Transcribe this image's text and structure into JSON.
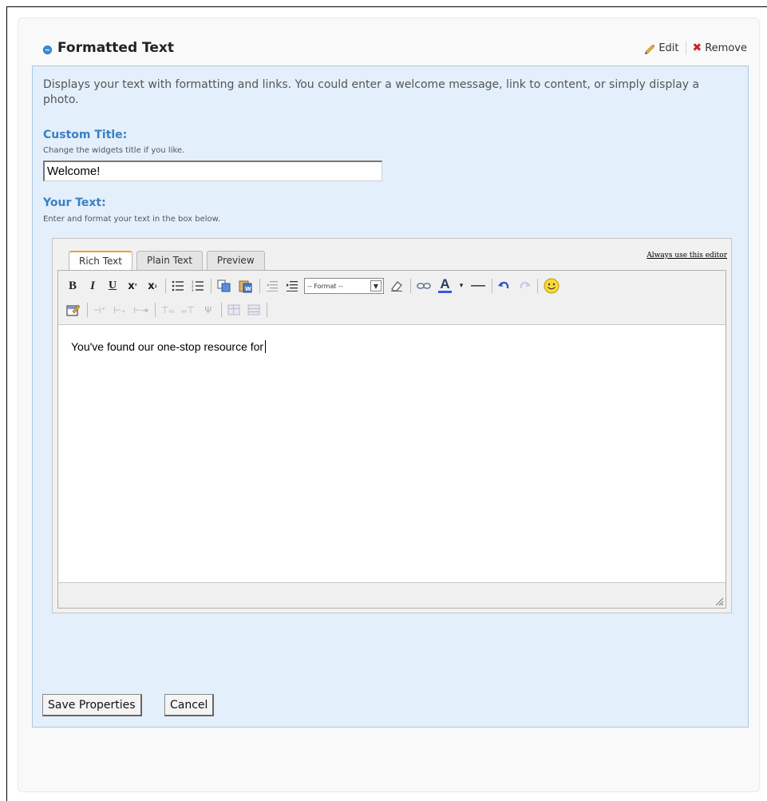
{
  "widget": {
    "title": "Formatted Text",
    "edit_label": "Edit",
    "remove_label": "Remove"
  },
  "description": "Displays your text with formatting and links. You could enter a welcome message, link to content, or simply display a photo.",
  "custom_title": {
    "label": "Custom Title:",
    "hint": "Change the widgets title if you like.",
    "value": "Welcome!"
  },
  "your_text": {
    "label": "Your Text:",
    "hint": "Enter and format your text in the box below."
  },
  "editor": {
    "tabs": [
      {
        "label": "Rich Text",
        "active": true
      },
      {
        "label": "Plain Text",
        "active": false
      },
      {
        "label": "Preview",
        "active": false
      }
    ],
    "always_use_label": "Always use this editor",
    "format_select_value": "-- Format --",
    "content": "You've found our one-stop resource for",
    "toolbar_icons_row1": [
      "bold-icon",
      "italic-icon",
      "underline-icon",
      "superscript-icon",
      "subscript-icon",
      "bullet-list-icon",
      "numbered-list-icon",
      "copy-icon",
      "paste-word-icon",
      "outdent-icon",
      "indent-icon",
      "format-select",
      "eraser-icon",
      "link-icon",
      "font-color-icon",
      "horizontal-rule-icon",
      "undo-icon",
      "redo-icon",
      "smiley-icon"
    ],
    "toolbar_icons_row2": [
      "edit-html-icon",
      "table-col-before-icon",
      "table-col-after-icon",
      "table-col-delete-icon",
      "table-row-before-icon",
      "table-row-after-icon",
      "table-merge-icon",
      "table-split-icon",
      "table-props-icon"
    ]
  },
  "buttons": {
    "save": "Save Properties",
    "cancel": "Cancel"
  },
  "colors": {
    "accent": "#3b7fc4",
    "panel_bg": "#e3effb",
    "panel_border": "#a9c8e5",
    "remove_red": "#d12020",
    "tab_active_top": "#f0a030"
  }
}
